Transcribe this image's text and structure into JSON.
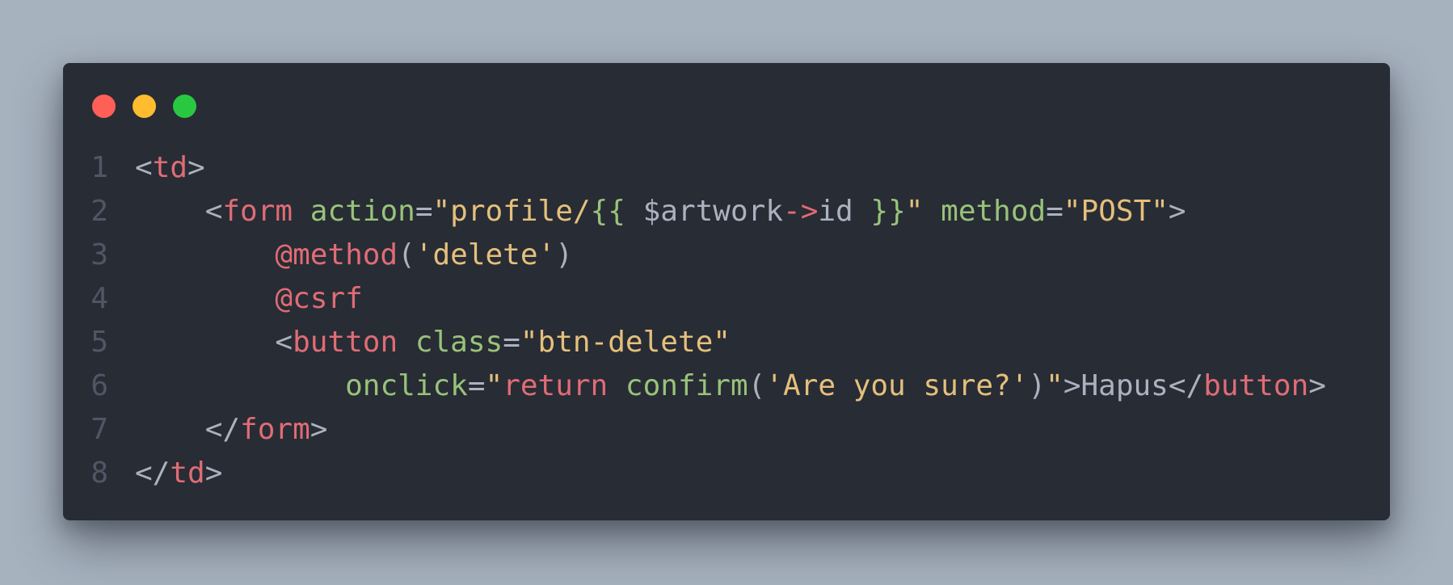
{
  "window": {
    "background": "#282c35",
    "controls": [
      {
        "name": "close",
        "color": "#fe5f57"
      },
      {
        "name": "minimize",
        "color": "#febc2e"
      },
      {
        "name": "maximize",
        "color": "#29c840"
      }
    ]
  },
  "editor": {
    "lines": [
      {
        "number": "1",
        "tokens": [
          {
            "t": "<",
            "c": "#abb2bf"
          },
          {
            "t": "td",
            "c": "#e06c75"
          },
          {
            "t": ">",
            "c": "#abb2bf"
          }
        ]
      },
      {
        "number": "2",
        "tokens": [
          {
            "t": "    <",
            "c": "#abb2bf"
          },
          {
            "t": "form",
            "c": "#e06c75"
          },
          {
            "t": " ",
            "c": "#abb2bf"
          },
          {
            "t": "action",
            "c": "#98c379"
          },
          {
            "t": "=",
            "c": "#abb2bf"
          },
          {
            "t": "\"profile/",
            "c": "#e5c07b"
          },
          {
            "t": "{{",
            "c": "#98c379"
          },
          {
            "t": " $artwork",
            "c": "#abb2bf"
          },
          {
            "t": "->",
            "c": "#e06c75"
          },
          {
            "t": "id ",
            "c": "#abb2bf"
          },
          {
            "t": "}}",
            "c": "#98c379"
          },
          {
            "t": "\"",
            "c": "#e5c07b"
          },
          {
            "t": " ",
            "c": "#abb2bf"
          },
          {
            "t": "method",
            "c": "#98c379"
          },
          {
            "t": "=",
            "c": "#abb2bf"
          },
          {
            "t": "\"POST\"",
            "c": "#e5c07b"
          },
          {
            "t": ">",
            "c": "#abb2bf"
          }
        ]
      },
      {
        "number": "3",
        "tokens": [
          {
            "t": "        ",
            "c": "#abb2bf"
          },
          {
            "t": "@method",
            "c": "#e06c75"
          },
          {
            "t": "(",
            "c": "#abb2bf"
          },
          {
            "t": "'delete'",
            "c": "#e5c07b"
          },
          {
            "t": ")",
            "c": "#abb2bf"
          }
        ]
      },
      {
        "number": "4",
        "tokens": [
          {
            "t": "        ",
            "c": "#abb2bf"
          },
          {
            "t": "@csrf",
            "c": "#e06c75"
          }
        ]
      },
      {
        "number": "5",
        "tokens": [
          {
            "t": "        <",
            "c": "#abb2bf"
          },
          {
            "t": "button",
            "c": "#e06c75"
          },
          {
            "t": " ",
            "c": "#abb2bf"
          },
          {
            "t": "class",
            "c": "#98c379"
          },
          {
            "t": "=",
            "c": "#abb2bf"
          },
          {
            "t": "\"btn-delete\"",
            "c": "#e5c07b"
          }
        ]
      },
      {
        "number": "6",
        "tokens": [
          {
            "t": "            ",
            "c": "#abb2bf"
          },
          {
            "t": "onclick",
            "c": "#98c379"
          },
          {
            "t": "=",
            "c": "#abb2bf"
          },
          {
            "t": "\"",
            "c": "#e5c07b"
          },
          {
            "t": "return",
            "c": "#e06c75"
          },
          {
            "t": " ",
            "c": "#abb2bf"
          },
          {
            "t": "confirm",
            "c": "#98c379"
          },
          {
            "t": "(",
            "c": "#abb2bf"
          },
          {
            "t": "'Are you sure?'",
            "c": "#e5c07b"
          },
          {
            "t": ")",
            "c": "#abb2bf"
          },
          {
            "t": "\"",
            "c": "#e5c07b"
          },
          {
            "t": ">Hapus</",
            "c": "#abb2bf"
          },
          {
            "t": "button",
            "c": "#e06c75"
          },
          {
            "t": ">",
            "c": "#abb2bf"
          }
        ]
      },
      {
        "number": "7",
        "tokens": [
          {
            "t": "    </",
            "c": "#abb2bf"
          },
          {
            "t": "form",
            "c": "#e06c75"
          },
          {
            "t": ">",
            "c": "#abb2bf"
          }
        ]
      },
      {
        "number": "8",
        "tokens": [
          {
            "t": "</",
            "c": "#abb2bf"
          },
          {
            "t": "td",
            "c": "#e06c75"
          },
          {
            "t": ">",
            "c": "#abb2bf"
          }
        ]
      }
    ]
  }
}
